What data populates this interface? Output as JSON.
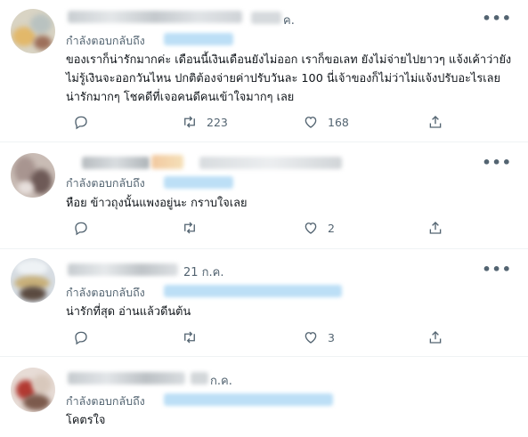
{
  "colors": {
    "text": "#0f1419",
    "muted": "#536471",
    "link_blur": "#bcdff6",
    "divider": "#eff3f4"
  },
  "icons": {
    "more": "more-horizontal-icon",
    "reply": "reply-icon",
    "retweet": "retweet-icon",
    "like": "heart-icon",
    "share": "share-icon"
  },
  "more_glyph": "•••",
  "tweets": [
    {
      "date_partial": "ค.",
      "reply_label": "กำลังตอบกลับถึง",
      "text": "ของเราก็น่ารักมากค่ะ เดือนนี้เงินเดือนยังไม่ออก เราก็ขอเลท ยังไม่จ่ายไปยาวๆ แจ้งเค้าว่ายังไม่รู้เงินจะออกวันไหน ปกติต้องจ่ายค่าปรับวันละ 100 นี่เจ้าของก็ไม่ว่าไม่แจ้งปรับอะไรเลย น่ารักมากๆ โชคดีที่เจอคนดีคนเข้าใจมากๆ เลย",
      "retweets": "223",
      "likes": "168"
    },
    {
      "reply_label": "กำลังตอบกลับถึง",
      "text": "หือย ข้าวถุงนั้นแพงอยู่นะ กราบใจเลย",
      "retweets": "",
      "likes": "2"
    },
    {
      "date": "21 ก.ค.",
      "reply_label": "กำลังตอบกลับถึง",
      "text": "น่ารักที่สุด อ่านแล้วดีนต้น",
      "retweets": "",
      "likes": "3"
    },
    {
      "date_partial": "ก.ค.",
      "reply_label": "กำลังตอบกลับถึง",
      "text": "โคตรใจ"
    }
  ]
}
